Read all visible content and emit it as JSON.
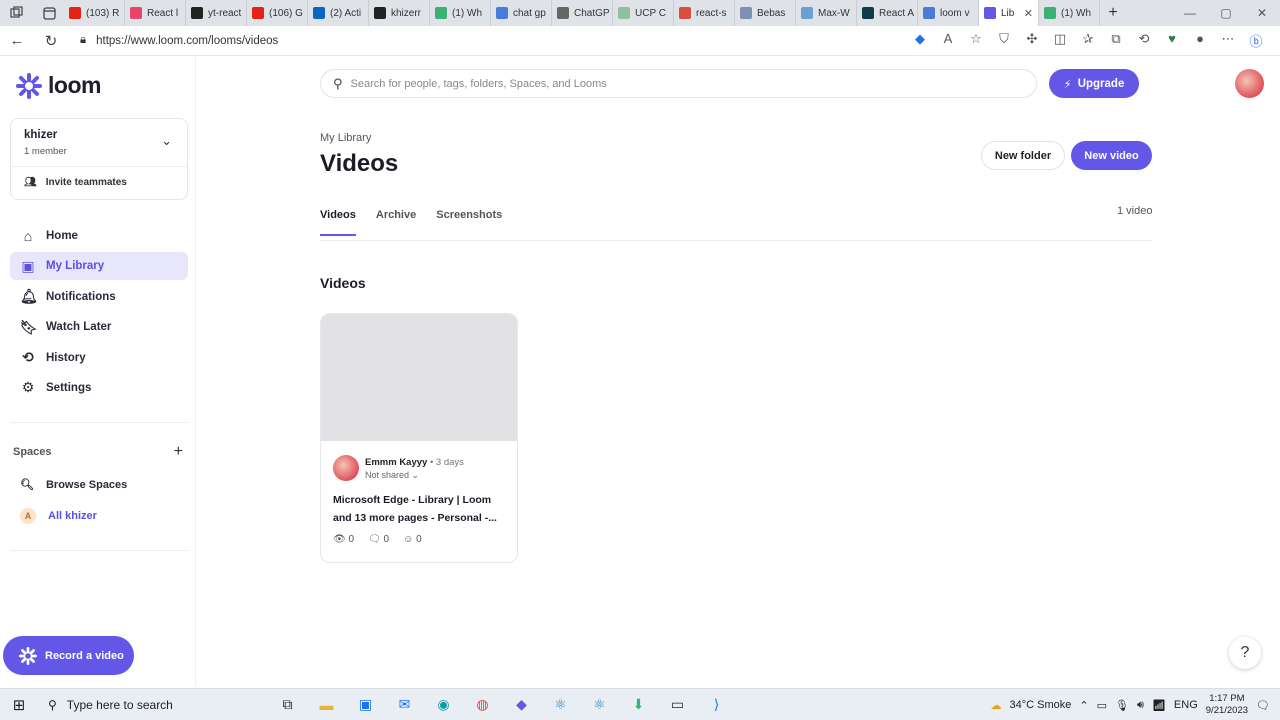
{
  "browser": {
    "tabs": [
      {
        "label": "(103) R",
        "color": "#e62117"
      },
      {
        "label": "React l",
        "color": "#e8456b"
      },
      {
        "label": "yt-react",
        "color": "#222222"
      },
      {
        "label": "(106) G",
        "color": "#e62117"
      },
      {
        "label": "(2) Acti",
        "color": "#0a66c2"
      },
      {
        "label": "khizerr",
        "color": "#222222"
      },
      {
        "label": "(1) Wh",
        "color": "#3bb273"
      },
      {
        "label": "chat gp",
        "color": "#4a7bd8"
      },
      {
        "label": "ChatGP",
        "color": "#666666"
      },
      {
        "label": "UCP C",
        "color": "#8fbf9f"
      },
      {
        "label": "react-s",
        "color": "#d94f3d"
      },
      {
        "label": "Bebas",
        "color": "#7d8fb3"
      },
      {
        "label": "Max-W",
        "color": "#6aa0d6"
      },
      {
        "label": "React A",
        "color": "#0f3b4a"
      },
      {
        "label": "loom v",
        "color": "#4a7bd8"
      },
      {
        "label": "Lib",
        "color": "#6357e8"
      },
      {
        "label": "(1) Wh",
        "color": "#3bb273"
      }
    ],
    "active_tab_index": 15,
    "url": "https://www.loom.com/looms/videos"
  },
  "sidebar": {
    "brand": "loom",
    "workspace": {
      "name": "khizer",
      "members": "1 member",
      "invite": "Invite teammates"
    },
    "nav": [
      {
        "label": "Home",
        "icon": "home-icon",
        "glyph": "⌂",
        "active": false
      },
      {
        "label": "My Library",
        "icon": "library-icon",
        "glyph": "▣",
        "active": true
      },
      {
        "label": "Notifications",
        "icon": "bell-icon",
        "glyph": "🔔︎",
        "active": false
      },
      {
        "label": "Watch Later",
        "icon": "bookmark-icon",
        "glyph": "🔖︎",
        "active": false
      },
      {
        "label": "History",
        "icon": "history-icon",
        "glyph": "⟲",
        "active": false
      },
      {
        "label": "Settings",
        "icon": "gear-icon",
        "glyph": "⚙",
        "active": false
      }
    ],
    "spaces_heading": "Spaces",
    "spaces": [
      {
        "label": "Browse Spaces",
        "icon": "search-icon"
      },
      {
        "label": "All khizer",
        "avatar": "A"
      }
    ],
    "record_label": "Record a video"
  },
  "main": {
    "search_placeholder": "Search for people, tags, folders, Spaces, and Looms",
    "upgrade_label": "Upgrade",
    "breadcrumb": "My Library",
    "title": "Videos",
    "new_folder_label": "New folder",
    "new_video_label": "New video",
    "tabs": [
      "Videos",
      "Archive",
      "Screenshots"
    ],
    "active_tab": "Videos",
    "count": "1 video",
    "section_heading": "Videos",
    "video": {
      "owner": "Emmm Kayyy",
      "age": "3 days",
      "sharing": "Not shared",
      "title": "Microsoft Edge - Library | Loom and 13 more pages - Personal -...",
      "views": "0",
      "comments": "0",
      "reactions": "0"
    },
    "help_label": "?"
  },
  "taskbar": {
    "search_placeholder": "Type here to search",
    "weather": "34°C  Smoke",
    "language": "ENG",
    "time": "1:17 PM",
    "date": "9/21/2023"
  },
  "colors": {
    "accent": "#6357e8",
    "accent_bg": "#e7e6fb"
  }
}
